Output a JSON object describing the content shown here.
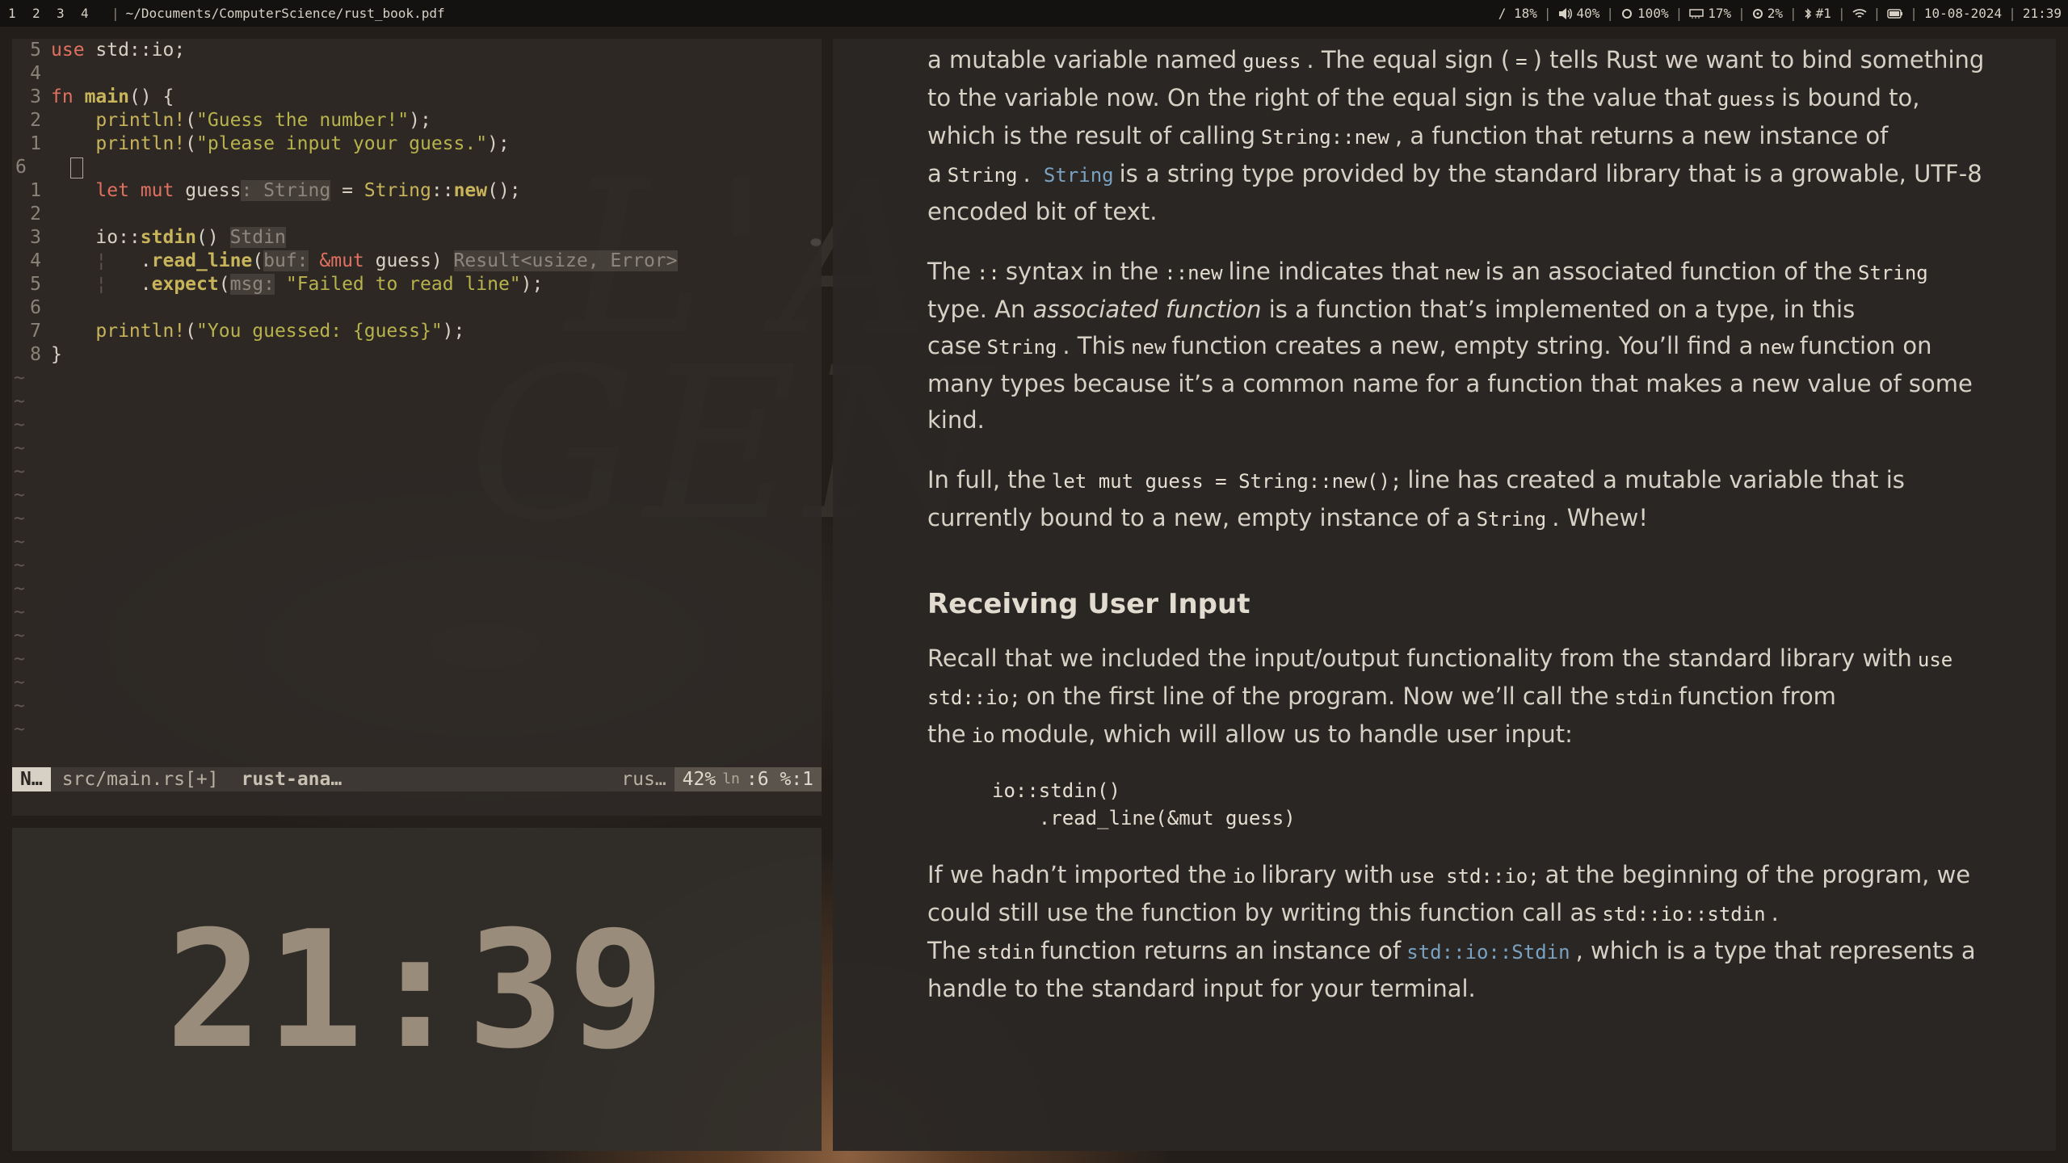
{
  "topbar": {
    "workspaces": [
      "1",
      "2",
      "3",
      "4"
    ],
    "path": "~/Documents/ComputerScience/rust_book.pdf",
    "status": {
      "disk": "/ 18%",
      "volume": "40%",
      "brightness": "100%",
      "memory": "17%",
      "cpu": "2%",
      "bluetooth": "#1",
      "date": "10-08-2024",
      "time": "21:39"
    }
  },
  "editor": {
    "statusline": {
      "mode": "N…",
      "file": "src/main.rs[+]",
      "lsp": "rust-ana…",
      "filetype": "rus…",
      "percent": "42%",
      "ln_label": "ln",
      "position": ":6 %:1"
    }
  },
  "clock": {
    "time": "21:39"
  },
  "pdf": {
    "p1": {
      "t1": "a mutable variable named",
      "c1": "guess",
      "t2": ". The equal sign (",
      "c2": "=",
      "t3": ") tells Rust we want to bind something to the variable now. On the right of the equal sign is the value that",
      "c3": "guess",
      "t4": "is bound to, which is the result of calling",
      "c4": "String::new",
      "t5": ", a function that returns a new instance of a",
      "c5": "String",
      "t6": ".",
      "c6": "String",
      "t7": "is a string type provided by the standard library that is a growable, UTF-8 encoded bit of text."
    },
    "p2": {
      "t1": "The",
      "c1": "::",
      "t2": "syntax in the",
      "c2": "::new",
      "t3": "line indicates that",
      "c3": "new",
      "t4": "is an associated function of the",
      "c4": "String",
      "t5": "type. An",
      "em": "associated function",
      "t6": "is a function that’s implemented on a type, in this case",
      "c5": "String",
      "t7": ". This",
      "c6": "new",
      "t8": "function creates a new, empty string. You’ll find a",
      "c7": "new",
      "t9": "function on many types because it’s a common name for a function that makes a new value of some kind."
    },
    "p3": {
      "t1": "In full, the",
      "c1": "let mut guess = String::new();",
      "t2": "line has created a mutable variable that is currently bound to a new, empty instance of a",
      "c2": "String",
      "t3": ". Whew!"
    },
    "heading": "Receiving User Input",
    "p4": {
      "t1": "Recall that we included the input/output functionality from the standard library with",
      "c1": "use std::io;",
      "t2": "on the first line of the program. Now we’ll call the",
      "c2": "stdin",
      "t3": "function from the",
      "c3": "io",
      "t4": "module, which will allow us to handle user input:"
    },
    "codeblock": "io::stdin()\n    .read_line(&mut guess)",
    "p5": {
      "t1": "If we hadn’t imported the",
      "c1": "io",
      "t2": "library with",
      "c2": "use std::io;",
      "t3": "at the beginning of the program, we could still use the function by writing this function call as",
      "c3": "std::io::stdin",
      "t4": ". The",
      "c4": "stdin",
      "t5": "function returns an instance of",
      "c5": "std::io::Stdin",
      "t6": ", which is a type that represents a handle to the standard input for your terminal."
    }
  },
  "colors": {
    "keyword": "#e07060",
    "function": "#c8b45a",
    "string": "#b8b24c",
    "link_code": "#7aa2c0",
    "clock_digits": "#9a8c7a"
  }
}
